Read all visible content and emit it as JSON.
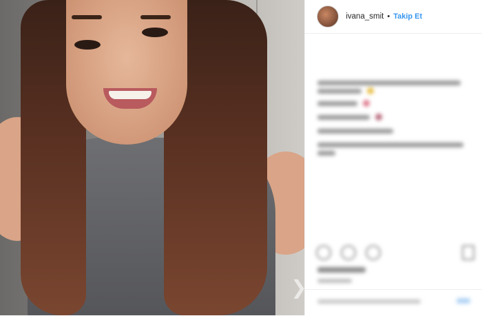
{
  "header": {
    "username": "ivana_smit",
    "separator": "•",
    "follow_label": "Takip Et"
  },
  "icons": {
    "avatar": "profile-avatar",
    "like": "heart-icon",
    "comment": "comment-icon",
    "share": "share-icon",
    "save": "bookmark-icon"
  },
  "colors": {
    "follow": "#3897f0",
    "text": "#262626"
  }
}
